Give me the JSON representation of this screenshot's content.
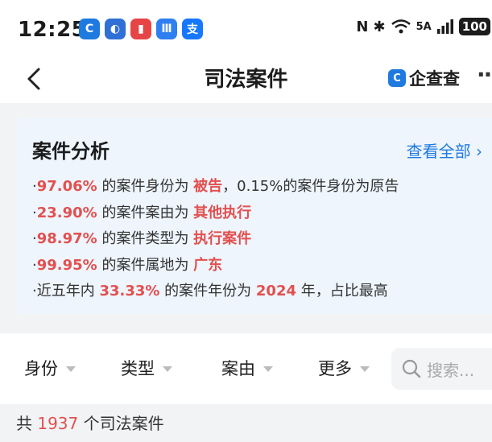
{
  "status_bar": {
    "time": "12:25",
    "battery": "100",
    "network": "5A",
    "apps": [
      {
        "icon": "app-icon-circle-blue",
        "color": "#1f7ae0",
        "glyph": "C"
      },
      {
        "icon": "app-icon-globe",
        "color": "#2f6fd6",
        "glyph": "◐"
      },
      {
        "icon": "app-icon-red-book",
        "color": "#e64545",
        "glyph": "▮"
      },
      {
        "icon": "app-icon-voice",
        "color": "#2f7ff0",
        "glyph": "Ⅲ"
      },
      {
        "icon": "app-icon-alipay",
        "color": "#1677ff",
        "glyph": "支"
      }
    ]
  },
  "nav": {
    "title": "司法案件",
    "brand_name": "企查查",
    "more": "··"
  },
  "analysis": {
    "title": "案件分析",
    "view_all": "查看全部 ›",
    "lines": [
      {
        "p1": "97.06%",
        "t1": " 的案件身份为 ",
        "p2": "被告",
        "t2": "，0.15%的案件身份为原告"
      },
      {
        "p1": "23.90%",
        "t1": " 的案件案由为 ",
        "p2": "其他执行",
        "t2": ""
      },
      {
        "p1": "98.97%",
        "t1": " 的案件类型为 ",
        "p2": "执行案件",
        "t2": ""
      },
      {
        "p1": "99.95%",
        "t1": " 的案件属地为 ",
        "p2": "广东",
        "t2": ""
      }
    ],
    "last_line": {
      "t0": "近五年内 ",
      "p1": "33.33%",
      "t1": " 的案件年份为 ",
      "p2": "2024",
      "t2": " 年，占比最高"
    }
  },
  "filters": {
    "identity": "身份",
    "type": "类型",
    "cause": "案由",
    "more": "更多",
    "search_placeholder": "搜索..."
  },
  "summary": {
    "prefix": "共 ",
    "count": "1937",
    "suffix": " 个司法案件"
  },
  "colors": {
    "accent": "#1f7ae0",
    "highlight": "#e2504f",
    "card_bg": "#eef5fd"
  }
}
